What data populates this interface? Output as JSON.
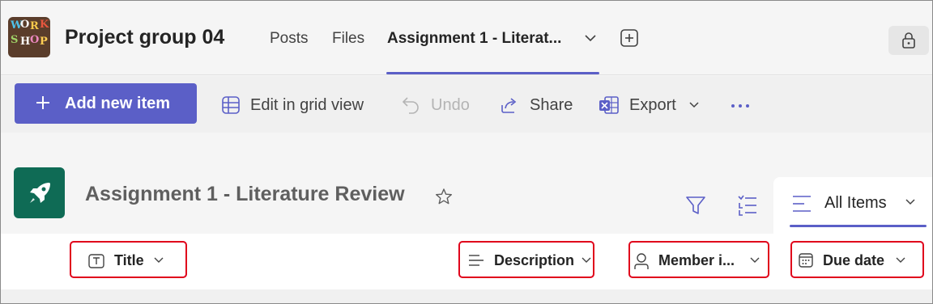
{
  "header": {
    "team_logo_letters": [
      "W",
      "O",
      "R",
      "K",
      "S",
      "H",
      "O",
      "P"
    ],
    "team_name": "Project group 04",
    "tabs": [
      {
        "label": "Posts",
        "active": false
      },
      {
        "label": "Files",
        "active": false
      },
      {
        "label": "Assignment 1 - Literat...",
        "active": true
      }
    ],
    "icons": {
      "tab_dropdown": "chevron-down-icon",
      "add_tab": "add-tab-icon",
      "lock": "lock-icon"
    }
  },
  "toolbar": {
    "add_new_item": "Add new item",
    "edit_grid": "Edit in grid view",
    "undo": "Undo",
    "share": "Share",
    "export": "Export",
    "more": "more-options-icon"
  },
  "list": {
    "title": "Assignment 1 - Literature Review",
    "view_name": "All Items",
    "icons": {
      "list": "rocket-icon",
      "favorite": "star-icon",
      "filter": "filter-icon",
      "fields": "field-list-icon",
      "view": "lines-icon"
    }
  },
  "columns": [
    {
      "label": "Title",
      "icon": "text-field-icon"
    },
    {
      "label": "Description",
      "icon": "multiline-text-icon"
    },
    {
      "label": "Member i...",
      "icon": "person-icon"
    },
    {
      "label": "Due date",
      "icon": "calendar-icon"
    }
  ],
  "colors": {
    "accent": "#5b5fc7",
    "list_icon_bg": "#0f6b55",
    "highlight_border": "#e0001b"
  }
}
